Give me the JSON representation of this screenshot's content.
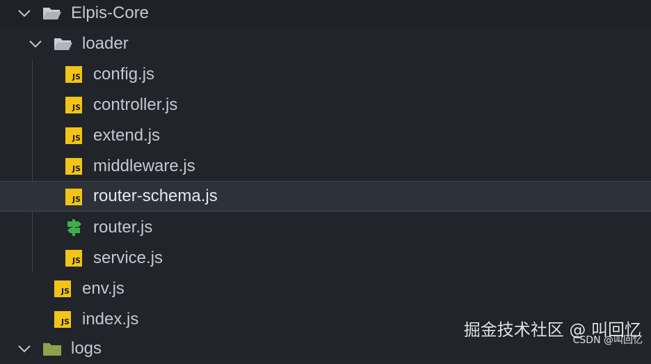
{
  "tree": {
    "root": {
      "label": "Elpis-Core",
      "icon": "folder-open-icon",
      "expanded": true
    },
    "loader": {
      "label": "loader",
      "icon": "folder-open-icon",
      "expanded": true
    },
    "loader_files": [
      {
        "label": "config.js",
        "icon": "js-file-icon",
        "badge": "JS"
      },
      {
        "label": "controller.js",
        "icon": "js-file-icon",
        "badge": "JS"
      },
      {
        "label": "extend.js",
        "icon": "js-file-icon",
        "badge": "JS"
      },
      {
        "label": "middleware.js",
        "icon": "js-file-icon",
        "badge": "JS"
      },
      {
        "label": "router-schema.js",
        "icon": "js-file-icon",
        "badge": "JS",
        "selected": true
      },
      {
        "label": "router.js",
        "icon": "router-signpost-icon"
      },
      {
        "label": "service.js",
        "icon": "js-file-icon",
        "badge": "JS"
      }
    ],
    "root_files": [
      {
        "label": "env.js",
        "icon": "js-file-icon",
        "badge": "JS"
      },
      {
        "label": "index.js",
        "icon": "js-file-icon",
        "badge": "JS"
      }
    ],
    "next_folder": {
      "label": "logs",
      "icon": "folder-icon"
    }
  },
  "colors": {
    "background": "#21252b",
    "selected_row": "#2c313a",
    "js_badge": "#f2c418",
    "router_icon": "#3fae4a",
    "folder_icon": "#c8ccd4"
  },
  "watermark": {
    "main": "掘金技术社区 @ 叫回忆",
    "sub": "CSDN @叫回忆"
  }
}
